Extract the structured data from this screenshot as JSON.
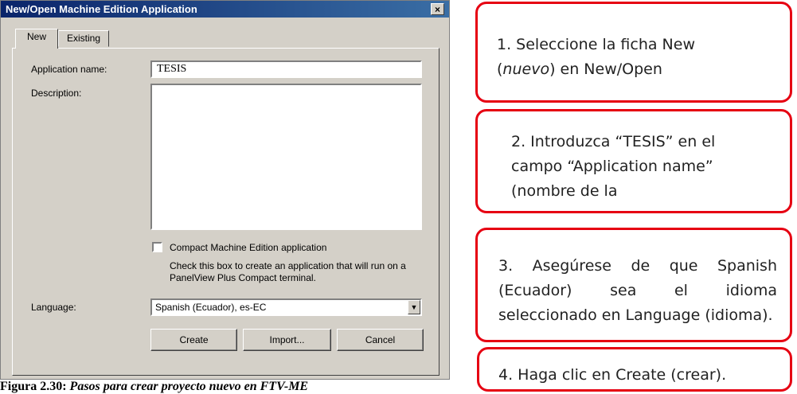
{
  "dialog": {
    "title": "New/Open Machine Edition Application",
    "close_label": "×",
    "tabs": [
      "New",
      "Existing"
    ],
    "app_name_label": "Application name:",
    "app_name_value": "TESIS",
    "description_label": "Description:",
    "compact_label": "Compact Machine Edition application",
    "compact_help": "Check this box to create an application that will run on a PanelView Plus Compact terminal.",
    "language_label": "Language:",
    "language_value": "Spanish (Ecuador), es-EC",
    "buttons": {
      "create": "Create",
      "import": "Import...",
      "cancel": "Cancel"
    }
  },
  "callouts": [
    {
      "text_a": "1. Seleccione la ficha New",
      "text_b_pre": "(",
      "text_b_em": "nuevo",
      "text_b_post": ") en New/Open"
    },
    {
      "text": "2. Introduzca “TESIS” en el campo “Application name” (nombre de la"
    },
    {
      "text": "3. Asegúrese de que Spanish (Ecuador) sea el idioma seleccionado en Language (idioma)."
    },
    {
      "text": "4. Haga clic en Create (crear)."
    }
  ],
  "caption": {
    "label": "Figura 2.30:",
    "text": " Pasos para crear proyecto nuevo en FTV-ME"
  },
  "colors": {
    "callout_border": "#e60012",
    "titlebar": "#0a246a",
    "dialog_bg": "#d4d0c8"
  }
}
